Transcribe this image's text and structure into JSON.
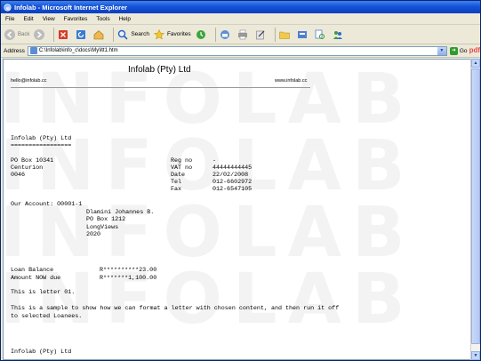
{
  "window": {
    "title": "Infolab - Microsoft Internet Explorer"
  },
  "menu": [
    "File",
    "Edit",
    "View",
    "Favorites",
    "Tools",
    "Help"
  ],
  "toolbar": {
    "back": "Back",
    "search": "Search",
    "favorites": "Favorites"
  },
  "address": {
    "label": "Address",
    "url": "C:\\Infolab\\info_c\\docs\\My\\ltt1.htm",
    "go": "Go",
    "extra": "pdf"
  },
  "letterhead": {
    "company": "Infolab (Pty) Ltd",
    "email": "hello@infolab.cc",
    "website": "www.infolab.cc"
  },
  "watermark": [
    "INFOLAB",
    "INFOLAB",
    "INFOLAB",
    "INFOLAB"
  ],
  "letter": {
    "company": "Infolab (Pty) Ltd",
    "underline": "=================",
    "address_left": [
      "PO Box 10341",
      "Centurion",
      "0046"
    ],
    "details": [
      {
        "label": "Reg no",
        "value": "-"
      },
      {
        "label": "VAT no",
        "value": "44444444445"
      },
      {
        "label": "Date",
        "value": "22/02/2008"
      },
      {
        "label": "Tel",
        "value": "012-6602972"
      },
      {
        "label": "Fax",
        "value": "012-6547105"
      }
    ],
    "account_label": "Our Account: O0001-1",
    "recipient": [
      "Dlamini Johannes B.",
      "PO Box 1212",
      "LongViews",
      "2020"
    ],
    "balances": [
      {
        "label": "Loan Balance",
        "value": "R**********23.00"
      },
      {
        "label": "Amount NOW due",
        "value": "R*******1,100.00"
      }
    ],
    "line1": "This is letter 01.",
    "paragraph": "This is a sample to show how we can format a letter with chosen content, and then run it off\nto selected Loanees.",
    "signoff": "Infolab (Pty) Ltd"
  }
}
